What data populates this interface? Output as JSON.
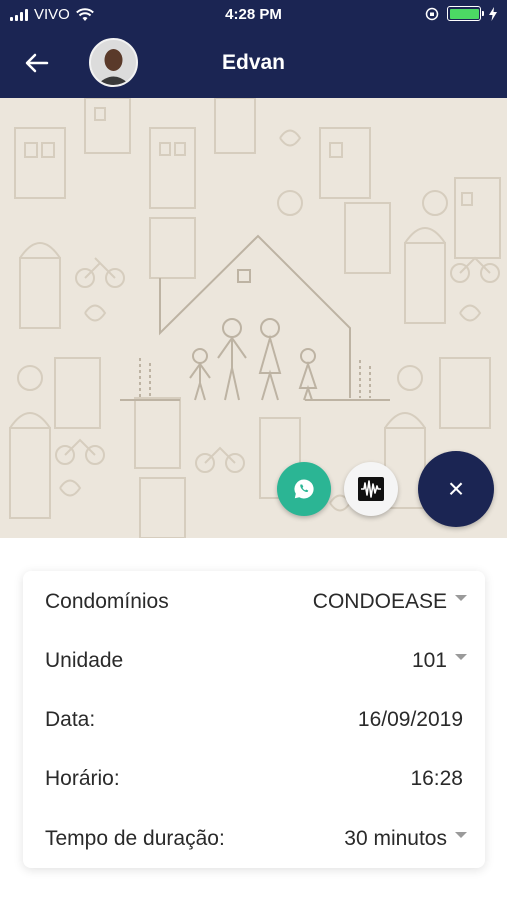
{
  "status_bar": {
    "carrier": "VIVO",
    "time": "4:28 PM",
    "battery_color": "#4cd964"
  },
  "header": {
    "title": "Edvan",
    "back_icon": "arrow-left-icon",
    "avatar": "user-avatar"
  },
  "actions": {
    "whatsapp_icon": "whatsapp-icon",
    "audio_icon": "audio-wave-icon",
    "close_label": "×"
  },
  "form": {
    "rows": [
      {
        "label": "Condomínios",
        "value": "CONDOEASE",
        "dropdown": true
      },
      {
        "label": "Unidade",
        "value": "101",
        "dropdown": true
      },
      {
        "label": "Data:",
        "value": "16/09/2019",
        "dropdown": false
      },
      {
        "label": "Horário:",
        "value": "16:28",
        "dropdown": false
      },
      {
        "label": "Tempo de duração:",
        "value": "30 minutos",
        "dropdown": true
      }
    ]
  },
  "colors": {
    "navy": "#1b2553",
    "whatsapp_green": "#2bb594",
    "wallpaper": "#ece6dc"
  }
}
